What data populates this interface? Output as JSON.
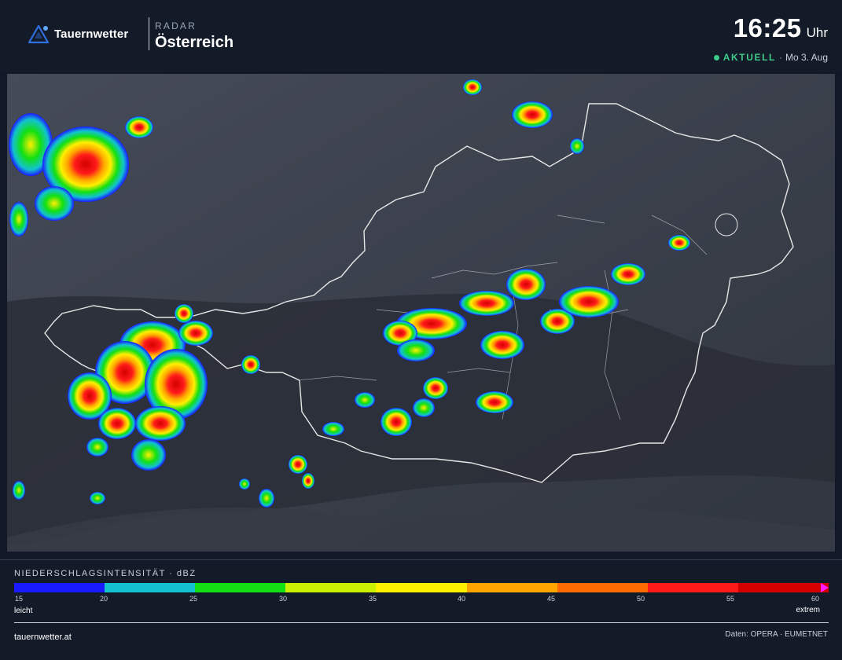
{
  "header": {
    "brand": "Tauernwetter",
    "kicker": "RADAR",
    "title": "Österreich",
    "time": "16:25",
    "time_unit": "Uhr",
    "status_live": "AKTUELL",
    "status_sep": "·",
    "status_date": "Mo 3. Aug"
  },
  "colors": {
    "accent": "#3ec98a",
    "background": "#111827",
    "brand_icon": "#2f6fe0",
    "map_ground": "#3a3f4a"
  },
  "map": {
    "description_icon": "radar-map"
  },
  "legend": {
    "title": "NIEDERSCHLAGSINTENSITÄT · dBZ",
    "ticks": [
      "15",
      "20",
      "25",
      "30",
      "35",
      "40",
      "45",
      "50",
      "55",
      "60"
    ],
    "colors": [
      "#1a1aff",
      "#12c3cf",
      "#12e012",
      "#c8f000",
      "#fff000",
      "#ffa500",
      "#ff6a00",
      "#ff1a1a",
      "#d40000"
    ],
    "end_color": "#ff1aff",
    "left_label": "leicht",
    "right_label": "extrem"
  },
  "footer": {
    "site": "tauernwetter.at",
    "credits": "Daten: OPERA · EUMETNET"
  }
}
